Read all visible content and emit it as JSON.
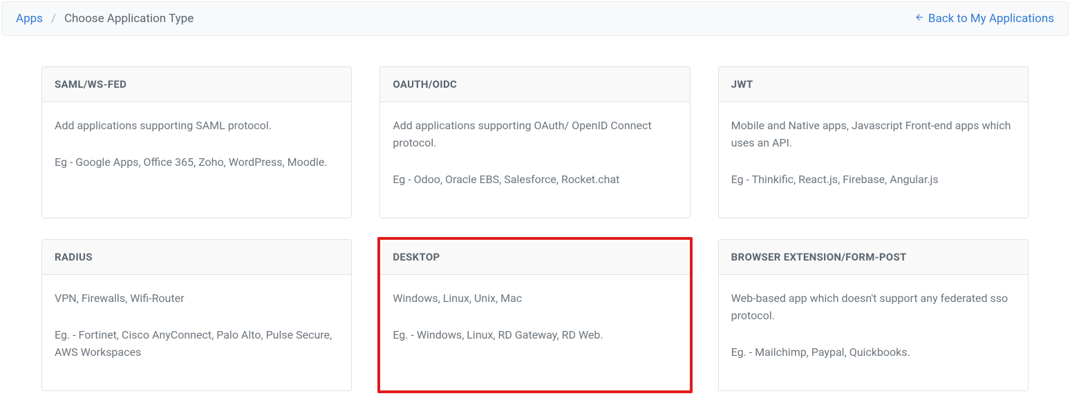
{
  "breadcrumb": {
    "root": "Apps",
    "current": "Choose Application Type"
  },
  "back_link": "Back to My Applications",
  "cards": [
    {
      "title": "SAML/WS-FED",
      "desc": "Add applications supporting SAML protocol.",
      "example": "Eg - Google Apps, Office 365, Zoho, WordPress, Moodle."
    },
    {
      "title": "OAUTH/OIDC",
      "desc": "Add applications supporting OAuth/ OpenID Connect protocol.",
      "example": "Eg - Odoo, Oracle EBS, Salesforce, Rocket.chat"
    },
    {
      "title": "JWT",
      "desc": "Mobile and Native apps, Javascript Front-end apps which uses an API.",
      "example": "Eg - Thinkific, React.js, Firebase, Angular.js"
    },
    {
      "title": "RADIUS",
      "desc": "VPN, Firewalls, Wifi-Router",
      "example": "Eg. - Fortinet, Cisco AnyConnect, Palo Alto, Pulse Secure, AWS Workspaces"
    },
    {
      "title": "DESKTOP",
      "desc": "Windows, Linux, Unix, Mac",
      "example": "Eg. - Windows, Linux, RD Gateway, RD Web."
    },
    {
      "title": "BROWSER EXTENSION/FORM-POST",
      "desc": "Web-based app which doesn't support any federated sso protocol.",
      "example": "Eg. - Mailchimp, Paypal, Quickbooks."
    }
  ],
  "highlight_index": 4
}
